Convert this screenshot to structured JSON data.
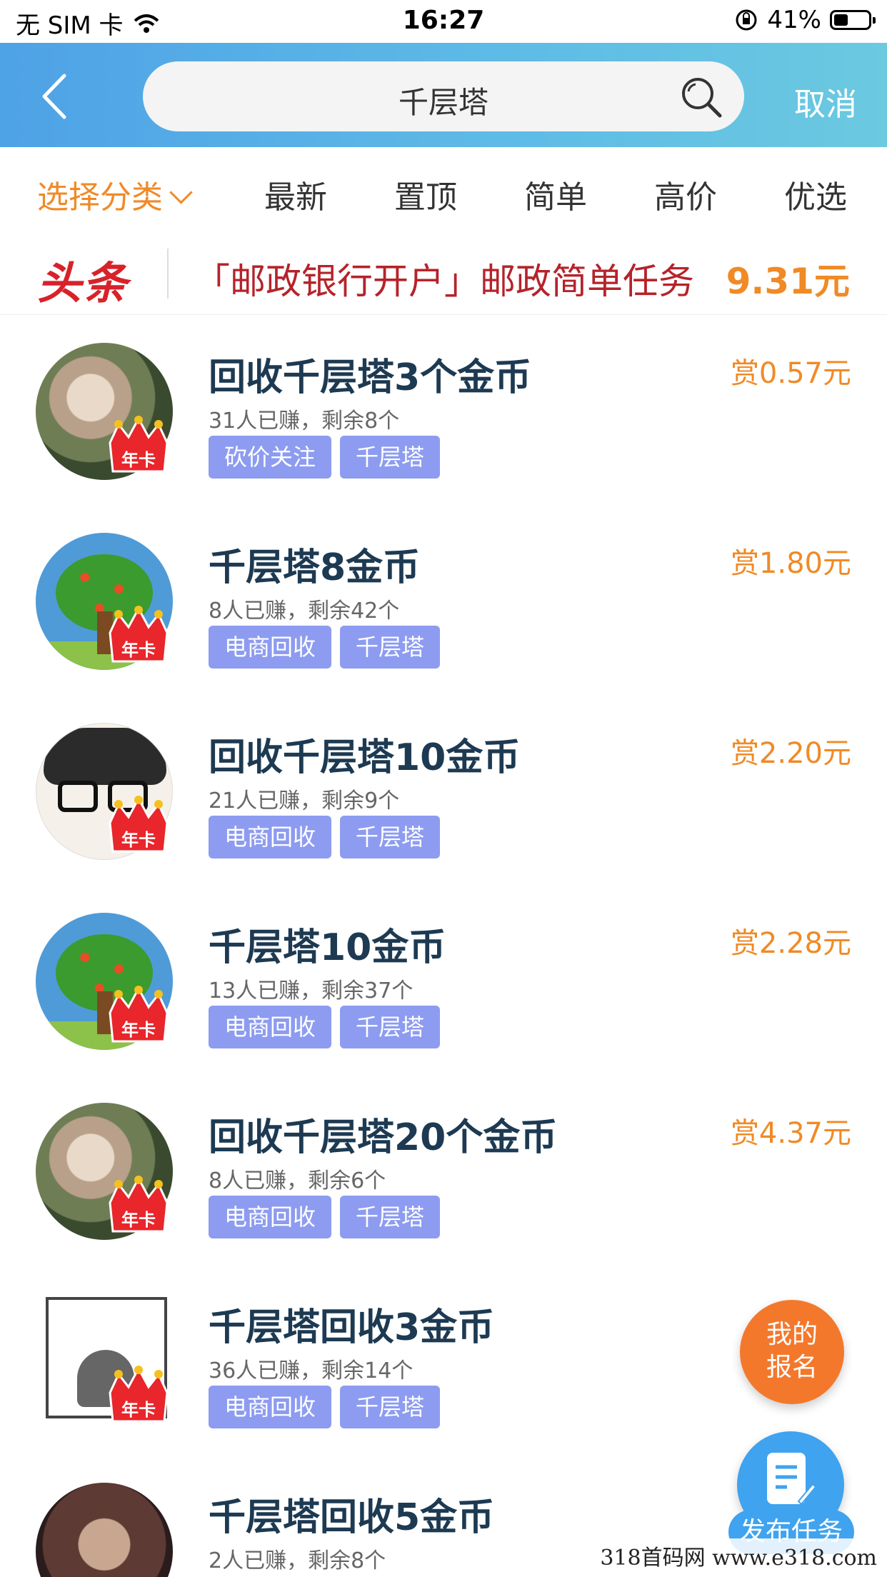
{
  "status_bar": {
    "carrier": "无 SIM 卡",
    "time": "16:27",
    "battery_percent": "41%",
    "battery_level": 0.41
  },
  "search": {
    "query": "千层塔",
    "cancel_label": "取消"
  },
  "filters": {
    "category_label": "选择分类",
    "items": [
      "最新",
      "置顶",
      "简单",
      "高价",
      "优选"
    ]
  },
  "headline": {
    "logo_text": "头条",
    "text": "「邮政银行开户」邮政简单任务",
    "amount": "9.31元"
  },
  "badge_label": "年卡",
  "tasks": [
    {
      "title": "回收千层塔3个金币",
      "stats": "31人已赚，剩余8个",
      "tags": [
        "砍价关注",
        "千层塔"
      ],
      "reward": "赏0.57元",
      "avatar": "photo"
    },
    {
      "title": "千层塔8金币",
      "stats": "8人已赚，剩余42个",
      "tags": [
        "电商回收",
        "千层塔"
      ],
      "reward": "赏1.80元",
      "avatar": "tree"
    },
    {
      "title": "回收千层塔10金币",
      "stats": "21人已赚，剩余9个",
      "tags": [
        "电商回收",
        "千层塔"
      ],
      "reward": "赏2.20元",
      "avatar": "face"
    },
    {
      "title": "千层塔10金币",
      "stats": "13人已赚，剩余37个",
      "tags": [
        "电商回收",
        "千层塔"
      ],
      "reward": "赏2.28元",
      "avatar": "tree"
    },
    {
      "title": "回收千层塔20个金币",
      "stats": "8人已赚，剩余6个",
      "tags": [
        "电商回收",
        "千层塔"
      ],
      "reward": "赏4.37元",
      "avatar": "photo"
    },
    {
      "title": "千层塔回收3金币",
      "stats": "36人已赚，剩余14个",
      "tags": [
        "电商回收",
        "千层塔"
      ],
      "reward": "",
      "avatar": "square"
    },
    {
      "title": "千层塔回收5金币",
      "stats": "2人已赚，剩余8个",
      "tags": [],
      "reward": "",
      "avatar": "dark"
    }
  ],
  "fab": {
    "signup_line1": "我的",
    "signup_line2": "报名",
    "publish_label": "发布任务"
  },
  "watermark": "318首码网  www.e318.com",
  "colors": {
    "header_start": "#4ea2e6",
    "header_end": "#6bc9e0",
    "accent_orange": "#f08a26",
    "headline_red": "#d8222a",
    "tag_bg": "#8d9cf0",
    "title_color": "#1d3a52",
    "fab_orange": "#f4782c",
    "fab_blue": "#3fa3ef"
  }
}
